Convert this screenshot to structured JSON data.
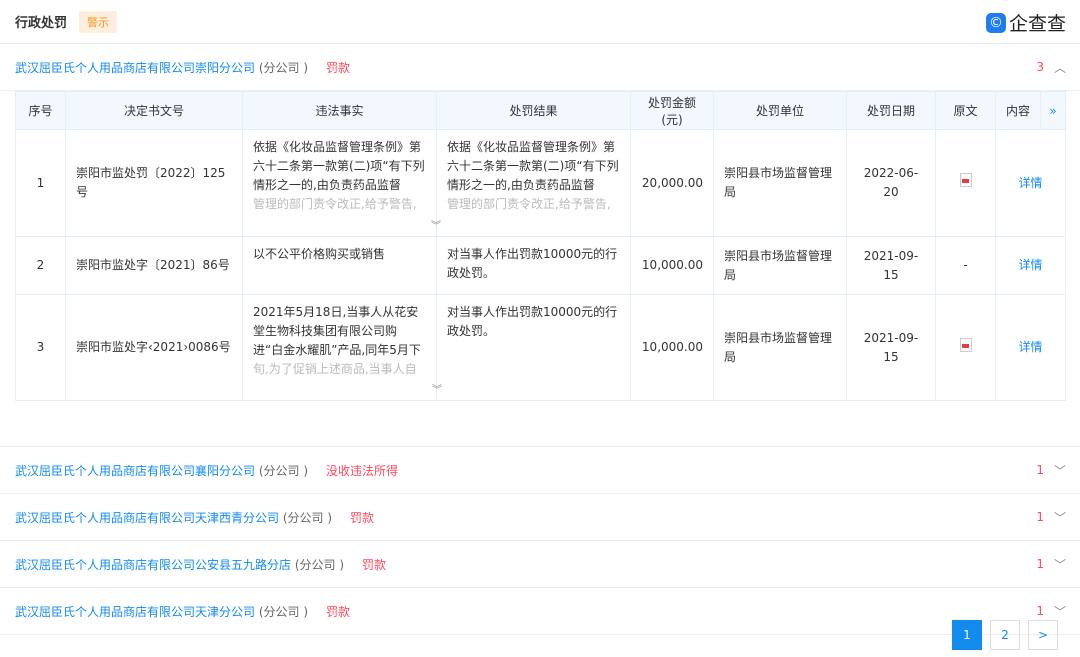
{
  "header": {
    "title": "行政处罚",
    "badge": "警示",
    "logo_text": "企查查"
  },
  "sections": [
    {
      "company": "武汉屈臣氏个人用品商店有限公司崇阳分公司",
      "type": "(分公司 )",
      "tag": "罚款",
      "count": "3",
      "expanded": true
    },
    {
      "company": "武汉屈臣氏个人用品商店有限公司襄阳分公司",
      "type": "(分公司 )",
      "tag": "没收违法所得",
      "count": "1"
    },
    {
      "company": "武汉屈臣氏个人用品商店有限公司天津西青分公司",
      "type": "(分公司 )",
      "tag": "罚款",
      "count": "1"
    },
    {
      "company": "武汉屈臣氏个人用品商店有限公司公安县五九路分店",
      "type": "(分公司 )",
      "tag": "罚款",
      "count": "1"
    },
    {
      "company": "武汉屈臣氏个人用品商店有限公司天津分公司",
      "type": "(分公司 )",
      "tag": "罚款",
      "count": "1"
    }
  ],
  "table": {
    "headers": [
      "序号",
      "决定书文号",
      "违法事实",
      "处罚结果",
      "处罚金额(元)",
      "处罚单位",
      "处罚日期",
      "原文",
      "内容"
    ],
    "rows": [
      {
        "no": "1",
        "doc": "崇阳市监处罚〔2022〕125号",
        "fact": "依据《化妆品监督管理条例》第六十二条第一款第(二)项“有下列情形之一的,由负责药品监督",
        "fact_fade": "管理的部门责令改正,给予警告,",
        "result": "依据《化妆品监督管理条例》第六十二条第一款第(二)项“有下列情形之一的,由负责药品监督",
        "result_fade": "管理的部门责令改正,给予警告,",
        "amount": "20,000.00",
        "unit": "崇阳县市场监督管理局",
        "date": "2022-06-20",
        "original": "pdf",
        "detail": "详情"
      },
      {
        "no": "2",
        "doc": "崇阳市监处字〔2021〕86号",
        "fact": "以不公平价格购买或销售",
        "result": "对当事人作出罚款10000元的行政处罚。",
        "amount": "10,000.00",
        "unit": "崇阳县市场监督管理局",
        "date": "2021-09-15",
        "original": "-",
        "detail": "详情"
      },
      {
        "no": "3",
        "doc": "崇阳市监处字‹2021›0086号",
        "fact": "2021年5月18日,当事人从花安堂生物科技集团有限公司购进“白金水耀肌”产品,同年5月下",
        "fact_fade": "旬,为了促销上述商品,当事人自",
        "result": "对当事人作出罚款10000元的行政处罚。",
        "amount": "10,000.00",
        "unit": "崇阳县市场监督管理局",
        "date": "2021-09-15",
        "original": "pdf",
        "detail": "详情"
      }
    ]
  },
  "pagination": {
    "pages": [
      "1",
      "2"
    ],
    "current": "1",
    "next": ">"
  }
}
